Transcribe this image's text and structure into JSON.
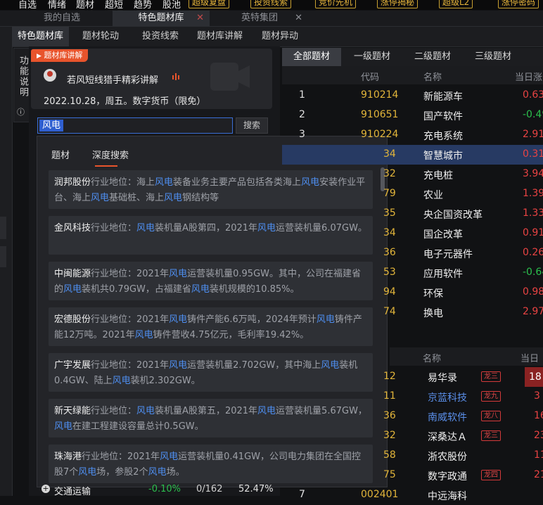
{
  "top_menu": {
    "items": [
      "自选",
      "情绪",
      "题材",
      "超短",
      "趋势",
      "股池"
    ],
    "buttons": [
      "超级复盘",
      "投资线索",
      "竞价先机",
      "涨停揭秘",
      "超级L2",
      "涨停密码"
    ]
  },
  "window_tabs": [
    {
      "label": "我的自选"
    },
    {
      "label": "特色题材库"
    },
    {
      "label": "英特集团"
    }
  ],
  "sub_tabs": [
    "特色题材库",
    "题材轮动",
    "投资线索",
    "题材库讲解",
    "题材异动"
  ],
  "side_label": "功能说明",
  "promo": {
    "tag": "题材库讲解",
    "title": "若风短线猎手精彩讲解",
    "date_line": "2022.10.28，周五。数字货币（限免）"
  },
  "search": {
    "value": "风电",
    "button": "搜索"
  },
  "popup": {
    "tabs": [
      "题材",
      "深度搜索"
    ],
    "keyword": "风电",
    "results": [
      {
        "name": "润邦股份",
        "parts": [
          "行业地位：海上",
          "风电",
          "装备业务主要产品包括各类海上",
          "风电",
          "安装作业平台、海上",
          "风电",
          "基础桩、海上",
          "风电",
          "钢结构等"
        ]
      },
      {
        "name": "金风科技",
        "parts": [
          "行业地位：",
          "风电",
          "装机量A股第四，2021年",
          "风电",
          "运营装机量6.07GW。"
        ]
      },
      {
        "name": "中闽能源",
        "parts": [
          "行业地位：2021年",
          "风电",
          "运营装机量0.95GW。其中，公司在福建省的",
          "风电",
          "装机共0.79GW，占福建省",
          "风电",
          "装机规模的10.85%。"
        ]
      },
      {
        "name": "宏德股份",
        "parts": [
          "行业地位：2021年",
          "风电",
          "铸件产能6.6万吨，2024年预计",
          "风电",
          "铸件产能12万吨。2021年",
          "风电",
          "铸件营收4.75亿元，毛利率19.42%。"
        ]
      },
      {
        "name": "广宇发展",
        "parts": [
          "行业地位：2021年",
          "风电",
          "运营装机量2.702GW，其中海上",
          "风电",
          "装机0.4GW、陆上",
          "风电",
          "装机2.302GW。"
        ]
      },
      {
        "name": "新天绿能",
        "parts": [
          "行业地位：",
          "风电",
          "装机量A股第五，2021年",
          "风电",
          "运营装机量5.67GW，",
          "风电",
          "在建工程建设容量总计0.5GW。"
        ]
      },
      {
        "name": "珠海港",
        "parts": [
          "行业地位：2021年",
          "风电",
          "运营装机量0.41GW，公司电力集团在全国控股7个",
          "风电",
          "场，参股2个",
          "风电",
          "场。"
        ]
      }
    ]
  },
  "bottom_row": {
    "name": "交通运输",
    "change": "-0.10%",
    "ratio": "0/162",
    "pct": "52.47%"
  },
  "right_tabs": [
    "全部题材",
    "一级题材",
    "二级题材",
    "三级题材"
  ],
  "right_headers": [
    "代码",
    "名称",
    "当日涨"
  ],
  "right_rows": [
    {
      "idx": "1",
      "code": "910214",
      "name": "新能源车",
      "chg": "0.63",
      "dir": "up"
    },
    {
      "idx": "2",
      "code": "910651",
      "name": "国产软件",
      "chg": "-0.49",
      "dir": "dn"
    },
    {
      "idx": "3",
      "code": "910224",
      "name": "充电系统",
      "chg": "2.91",
      "dir": "up"
    },
    {
      "idx": "",
      "code": "34",
      "name": "智慧城市",
      "chg": "0.31",
      "dir": "up"
    },
    {
      "idx": "",
      "code": "32",
      "name": "充电桩",
      "chg": "3.94",
      "dir": "up"
    },
    {
      "idx": "",
      "code": "79",
      "name": "农业",
      "chg": "1.39",
      "dir": "up"
    },
    {
      "idx": "",
      "code": "35",
      "name": "央企国资改革",
      "chg": "1.33",
      "dir": "up"
    },
    {
      "idx": "",
      "code": "34",
      "name": "国企改革",
      "chg": "0.91",
      "dir": "up"
    },
    {
      "idx": "",
      "code": "36",
      "name": "电子元器件",
      "chg": "0.26",
      "dir": "up"
    },
    {
      "idx": "",
      "code": "53",
      "name": "应用软件",
      "chg": "-0.64",
      "dir": "dn"
    },
    {
      "idx": "",
      "code": "94",
      "name": "环保",
      "chg": "0.98",
      "dir": "up"
    },
    {
      "idx": "",
      "code": "74",
      "name": "换电",
      "chg": "2.97",
      "dir": "up"
    }
  ],
  "right_headers2": [
    "名称",
    "当日"
  ],
  "right_rows2": [
    {
      "code": "12",
      "name": "易华录",
      "tag": "龙三",
      "val": "18"
    },
    {
      "code": "11",
      "name": "京蓝科技",
      "tag": "龙九",
      "val": "3"
    },
    {
      "code": "36",
      "name": "南威软件",
      "tag": "龙八",
      "val": "16"
    },
    {
      "code": "32",
      "name": "深桑达Ａ",
      "tag": "龙三",
      "val": "23"
    },
    {
      "code": "58",
      "name": "浙农股份",
      "tag": "",
      "val": "11"
    },
    {
      "code": "75",
      "name": "数字政通",
      "tag": "龙四",
      "val": "21"
    },
    {
      "code": "002401",
      "name": "中远海科",
      "tag": "",
      "val": ""
    }
  ],
  "colors": {
    "accent": "#e8542c",
    "keyword": "#4e8ef0",
    "up": "#e94343",
    "down": "#2bbf4d",
    "code": "#e2b53a"
  }
}
